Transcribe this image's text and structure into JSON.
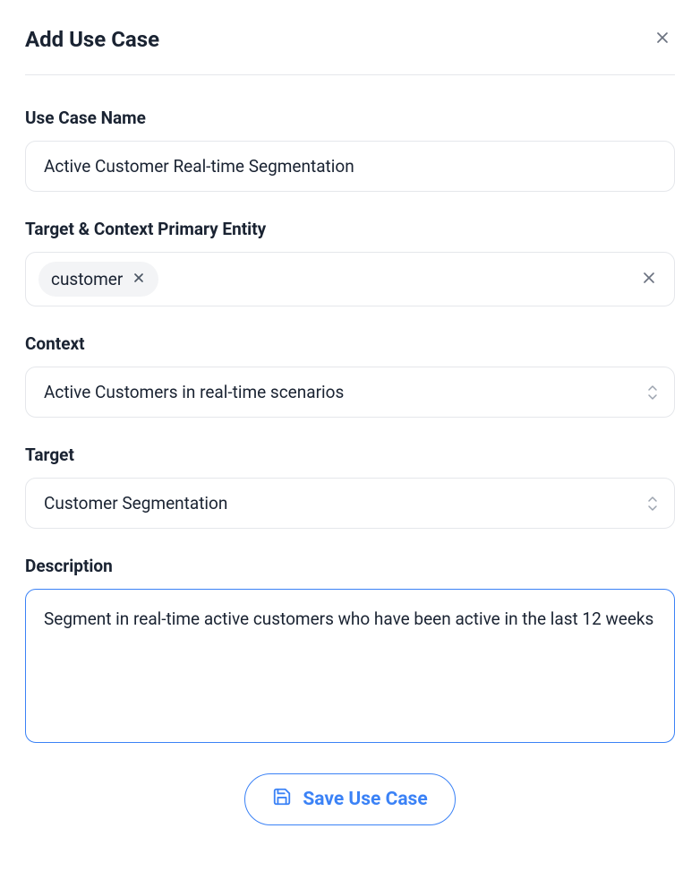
{
  "header": {
    "title": "Add Use Case"
  },
  "fields": {
    "name": {
      "label": "Use Case Name",
      "value": "Active Customer Real-time Segmentation"
    },
    "entity": {
      "label": "Target & Context Primary Entity",
      "tag": "customer"
    },
    "context": {
      "label": "Context",
      "value": "Active Customers in real-time scenarios"
    },
    "target": {
      "label": "Target",
      "value": "Customer Segmentation"
    },
    "description": {
      "label": "Description",
      "value": "Segment in real-time active customers who have been active in the last 12 weeks"
    }
  },
  "actions": {
    "save": "Save Use Case"
  }
}
